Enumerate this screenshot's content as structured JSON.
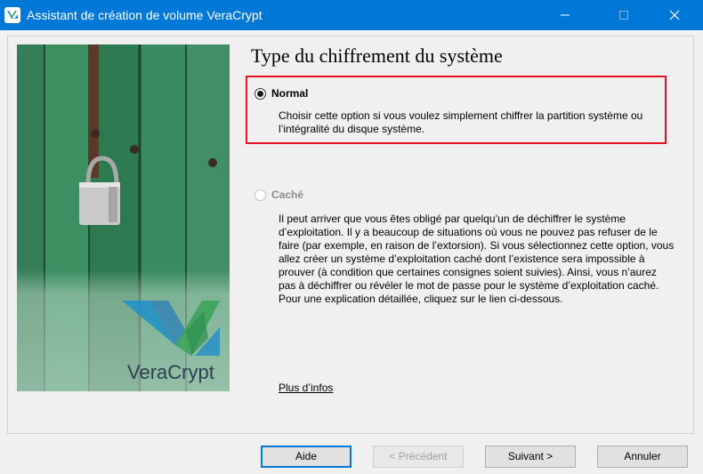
{
  "window": {
    "title": "Assistant de création de volume VeraCrypt",
    "icon": "veracrypt-logo-icon"
  },
  "page": {
    "title": "Type du chiffrement du système"
  },
  "options": [
    {
      "label": "Normal",
      "selected": true,
      "enabled": true,
      "description": "Choisir cette option si vous voulez simplement chiffrer la partition système ou l’intégralité du disque système."
    },
    {
      "label": "Caché",
      "selected": false,
      "enabled": false,
      "description": "Il peut arriver que vous êtes obligé par quelqu’un de déchiffrer le système d’exploitation. Il y a beaucoup de situations où vous ne pouvez pas refuser de le faire (par exemple, en raison de l’extorsion). Si vous sélectionnez cette option, vous allez créer un système d’exploitation caché dont l’existence sera impossible à prouver (à condition que certaines consignes soient suivies). Ainsi, vous n’aurez pas à déchiffrer ou révéler le mot de passe pour le système d’exploitation caché. Pour une explication détaillée, cliquez sur le lien ci-dessous."
    }
  ],
  "more_info_link": "Plus d’infos",
  "artwork": {
    "brand_text": "VeraCrypt"
  },
  "buttons": {
    "help": "Aide",
    "previous": "< Précédent",
    "next": "Suivant >",
    "cancel": "Annuler"
  },
  "colors": {
    "titlebar": "#0078d7",
    "highlight_border": "#e81123",
    "logo_blue": "#1f8fc9",
    "logo_green": "#3aa35a"
  }
}
